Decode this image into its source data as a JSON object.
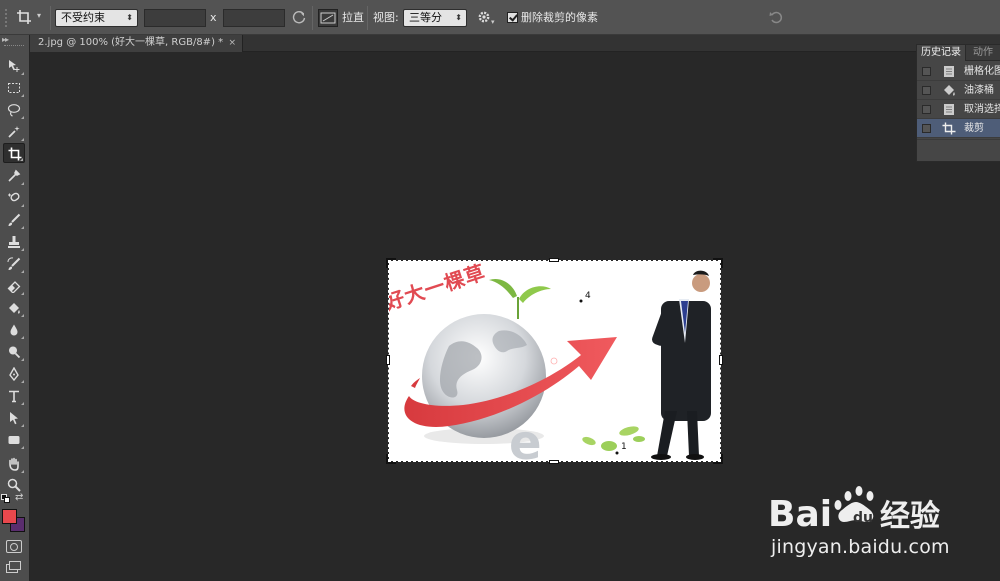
{
  "options_bar": {
    "tool_icon": "crop-icon",
    "ratio_select": "不受约束",
    "width_value": "",
    "height_value": "",
    "x_separator": "x",
    "straighten_label": "拉直",
    "view_label": "视图:",
    "view_select": "三等分",
    "delete_pixels_label": "删除裁剪的像素",
    "delete_pixels_checked": true
  },
  "document_tab": {
    "title": "2.jpg @ 100% (好大一棵草, RGB/8#) *",
    "close": "×"
  },
  "tools": [
    {
      "name": "move-tool-icon"
    },
    {
      "name": "marquee-tool-icon"
    },
    {
      "name": "lasso-tool-icon"
    },
    {
      "name": "quick-selection-tool-icon"
    },
    {
      "name": "crop-tool-icon",
      "active": true
    },
    {
      "name": "eyedropper-tool-icon"
    },
    {
      "name": "spot-healing-tool-icon"
    },
    {
      "name": "brush-tool-icon"
    },
    {
      "name": "clone-stamp-tool-icon"
    },
    {
      "name": "history-brush-tool-icon"
    },
    {
      "name": "eraser-tool-icon"
    },
    {
      "name": "paint-bucket-tool-icon"
    },
    {
      "name": "blur-tool-icon"
    },
    {
      "name": "dodge-tool-icon"
    },
    {
      "name": "pen-tool-icon"
    },
    {
      "name": "type-tool-icon"
    },
    {
      "name": "path-selection-tool-icon"
    },
    {
      "name": "rectangle-tool-icon"
    },
    {
      "name": "hand-tool-icon"
    },
    {
      "name": "zoom-tool-icon"
    }
  ],
  "colors": {
    "foreground": "#e8484d",
    "background": "#5a2d6e",
    "selected_history": "#4e5d78"
  },
  "history_panel": {
    "tabs": [
      "历史记录",
      "动作"
    ],
    "items": [
      {
        "label": "栅格化图",
        "icon": "document-icon"
      },
      {
        "label": "油漆桶",
        "icon": "paint-bucket-icon"
      },
      {
        "label": "取消选择",
        "icon": "document-icon"
      },
      {
        "label": "裁剪",
        "icon": "crop-icon",
        "selected": true
      }
    ]
  },
  "image": {
    "headline": "好大一棵草",
    "marker_1": "1",
    "marker_4": "4"
  },
  "watermark": {
    "brand": "Baidu经验",
    "url": "jingyan.baidu.com"
  }
}
